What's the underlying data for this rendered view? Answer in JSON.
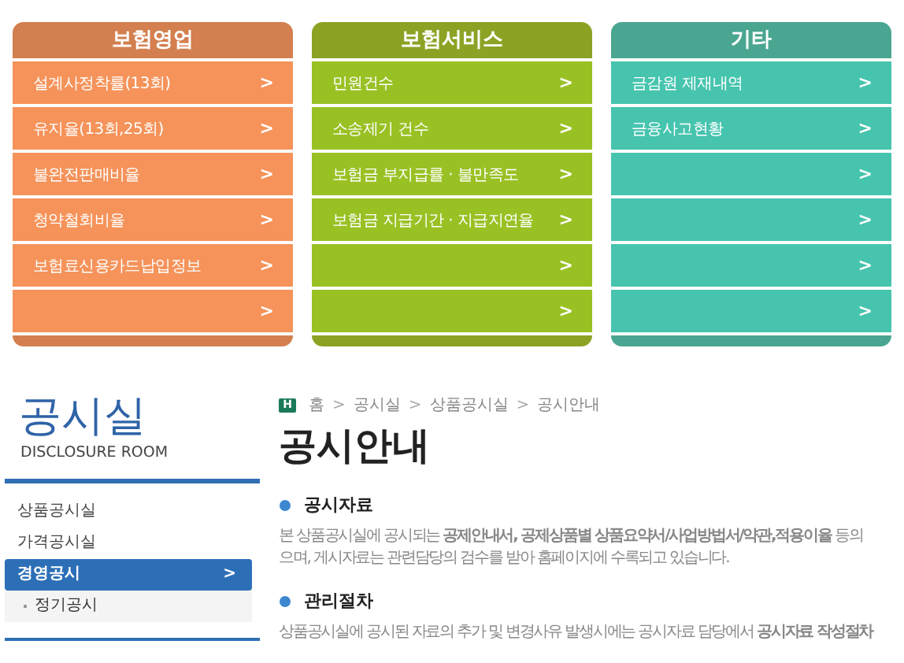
{
  "panels": [
    {
      "title": "보험영업",
      "color": "#f5935a",
      "items": [
        {
          "label": "설계사정착률(13회)",
          "arrow": ">"
        },
        {
          "label": "유지율(13회,25회)",
          "arrow": ">"
        },
        {
          "label": "불완전판매비율",
          "arrow": ">"
        },
        {
          "label": "청약철회비율",
          "arrow": ">"
        },
        {
          "label": "보험료신용카드납입정보",
          "arrow": ">"
        },
        {
          "arrow": ">"
        }
      ]
    },
    {
      "title": "보험서비스",
      "color": "#99c124",
      "items": [
        {
          "label": "민원건수",
          "arrow": ">"
        },
        {
          "label": "소송제기 건수",
          "arrow": ">"
        },
        {
          "label": "보험금 부지급률 · 불만족도",
          "arrow": ">"
        },
        {
          "label": "보험금 지급기간 · 지급지연율",
          "arrow": ">"
        },
        {
          "arrow": ">"
        },
        {
          "arrow": ">"
        }
      ]
    },
    {
      "title": "기타",
      "color": "#46c4ae",
      "items": [
        {
          "label": "금감원 제재내역",
          "arrow": ">"
        },
        {
          "label": "금융사고현황",
          "arrow": ">"
        },
        {
          "arrow": ">"
        },
        {
          "arrow": ">"
        },
        {
          "arrow": ">"
        },
        {
          "arrow": ">"
        }
      ]
    }
  ],
  "sidebar": {
    "title": "공시실",
    "subtitle": "DISCLOSURE ROOM",
    "items": [
      {
        "label": "상품공시실",
        "selected": false
      },
      {
        "label": "가격공시실",
        "selected": false
      },
      {
        "label": "경영공시",
        "selected": true,
        "arrow": ">"
      }
    ],
    "sub_items": [
      {
        "label": "정기공시"
      }
    ]
  },
  "breadcrumb": {
    "icon": "H",
    "items": [
      "홈",
      "공시실",
      "상품공시실",
      "공시안내"
    ],
    "separator": ">"
  },
  "page_title": "공시안내",
  "sections": [
    {
      "heading": "공시자료",
      "lines": [
        "본 상품공시실에 공시되는 **공제안내서, 공제상품별 상품요약서/사업방법서/약관,적용이율** 등의",
        "으며, 게시자료는 관련담당의 검수를 받아 홈페이지에 수록되고 있습니다."
      ]
    },
    {
      "heading": "관리절차",
      "lines": [
        "상품공시실에 공시된 자료의 추가 및 변경사유 발생시에는 공시자료 담당에서 **공시자료 작성절차**"
      ]
    }
  ]
}
